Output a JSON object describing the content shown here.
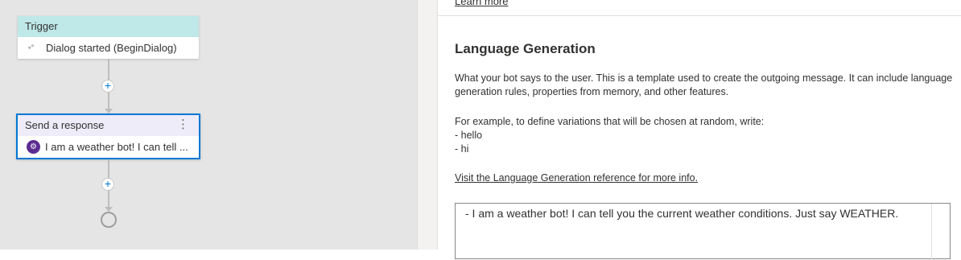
{
  "canvas": {
    "trigger": {
      "header": "Trigger",
      "icon": "trigger-icon",
      "label": "Dialog started (BeginDialog)"
    },
    "send_response": {
      "header": "Send a response",
      "more_icon": "⋮",
      "bot_icon": "bot-icon",
      "label": "I am a weather bot! I can tell ..."
    },
    "add_glyph": "+"
  },
  "panel": {
    "learn_more": "Learn more",
    "title": "Language Generation",
    "description": "What your bot says to the user. This is a template used to create the outgoing message. It can include language generation rules, properties from memory, and other features.",
    "example_intro": "For example, to define variations that will be chosen at random, write:",
    "example_line1": "- hello",
    "example_line2": "- hi",
    "reference_link": "Visit the Language Generation reference for more info.",
    "editor_text": "- I am a weather bot! I can tell you the current weather conditions. Just say WEATHER."
  },
  "colors": {
    "trigger_header": "#bfe8e8",
    "send_header": "#eeecf8",
    "selection_border": "#0078d4",
    "bot_icon": "#5c2d91",
    "canvas_bg": "#e5e5e5"
  }
}
